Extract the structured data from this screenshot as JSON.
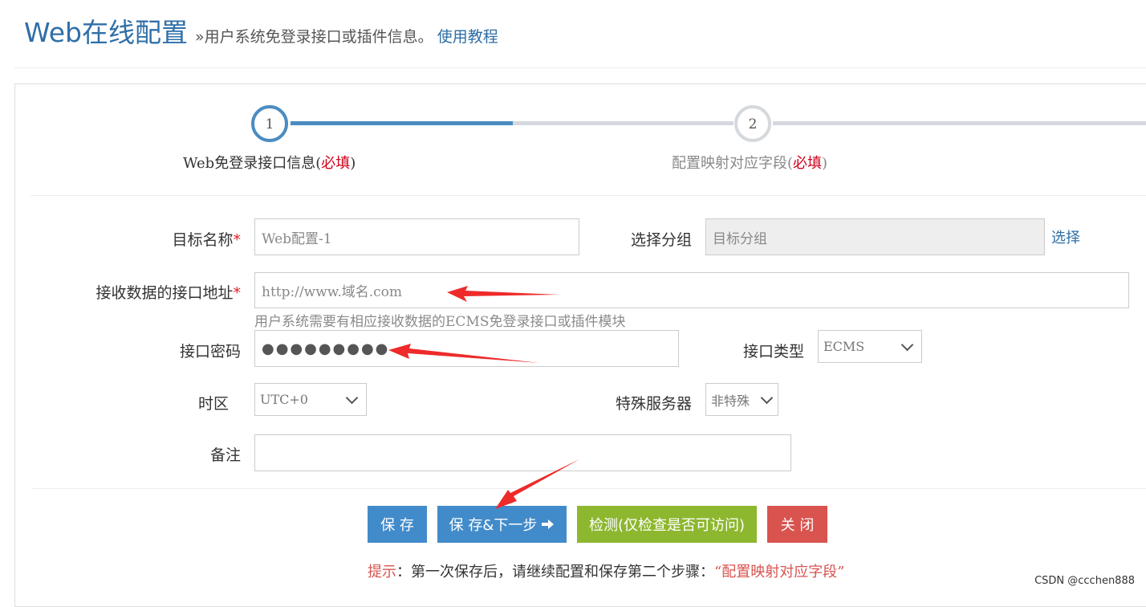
{
  "header": {
    "title": "Web在线配置",
    "subtitle": "»用户系统免登录接口或插件信息。",
    "tutorial_link": "使用教程"
  },
  "steps": [
    {
      "number": "1",
      "label": "Web免登录接口信息(",
      "required": "必填",
      "close": ")",
      "active": true
    },
    {
      "number": "2",
      "label": "配置映射对应字段(",
      "required": "必填",
      "close": ")",
      "active": false
    }
  ],
  "form": {
    "target_name": {
      "label": "目标名称",
      "star": "*",
      "value": "Web配置-1"
    },
    "group": {
      "label": "选择分组",
      "placeholder": "目标分组",
      "select_link": "选择"
    },
    "endpoint": {
      "label": "接收数据的接口地址",
      "star": "*",
      "placeholder": "http://www.域名.com",
      "help": "用户系统需要有相应接收数据的ECMS免登录接口或插件模块"
    },
    "password": {
      "label": "接口密码",
      "masked": "●●●●●●●●●"
    },
    "interface_type": {
      "label": "接口类型",
      "selected": "ECMS"
    },
    "timezone": {
      "label": "时区",
      "selected": "UTC+0"
    },
    "special_server": {
      "label": "特殊服务器",
      "selected": "非特殊"
    },
    "note": {
      "label": "备注",
      "value": ""
    }
  },
  "buttons": {
    "save": "保 存",
    "save_next": "保 存&下一步",
    "check": "检测(仅检查是否可访问)",
    "close": "关 闭"
  },
  "hint": {
    "prefix": "提示",
    "text": "：第一次保存后，请继续配置和保存第二个步骤：",
    "quote": "“配置映射对应字段”"
  },
  "watermark": "CSDN @ccchen888",
  "colors": {
    "primary": "#428bca",
    "success": "#8db72f",
    "danger": "#d9534f",
    "title": "#2f6fa8",
    "required": "#d0021b"
  }
}
